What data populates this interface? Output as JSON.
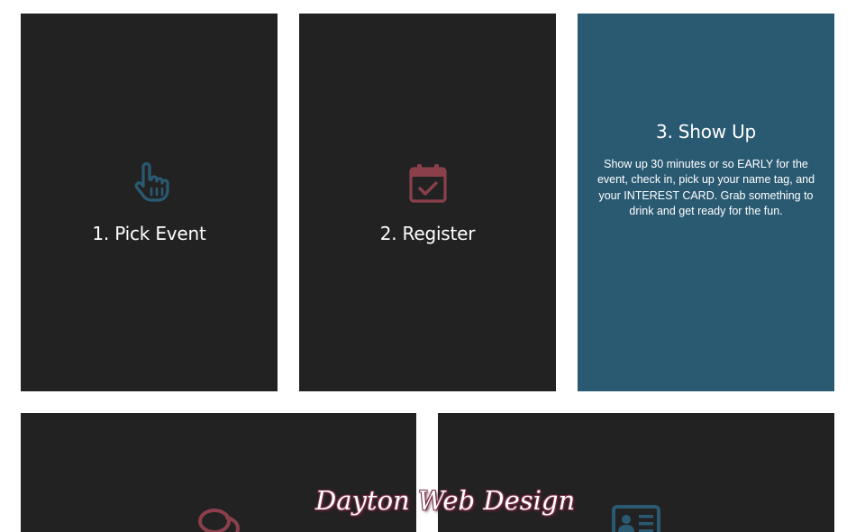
{
  "colors": {
    "card_dark": "#222222",
    "card_active": "#2a5a72",
    "icon_blue": "#2a5a72",
    "icon_red": "#8a3f4a",
    "text": "#ffffff"
  },
  "steps": [
    {
      "title": "1. Pick Event",
      "icon": "pointing-hand-icon",
      "text": ""
    },
    {
      "title": "2. Register",
      "icon": "calendar-check-icon",
      "text": ""
    },
    {
      "title": "3. Show Up",
      "icon": "",
      "text": "Show up 30 minutes or so EARLY for the event, check in, pick up your name tag, and your INTEREST CARD. Grab something to drink and get ready for the fun."
    }
  ],
  "bottom_cards": [
    {
      "icon": "chat-bubbles-icon"
    },
    {
      "icon": "id-card-icon"
    }
  ],
  "watermark": "Dayton Web Design"
}
